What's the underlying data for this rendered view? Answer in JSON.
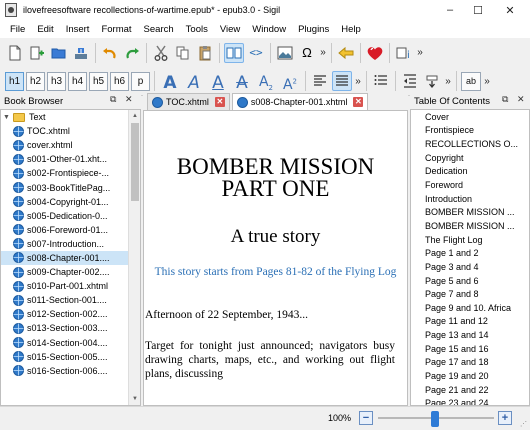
{
  "window": {
    "title": "ilovefreesoftware recollections-of-wartime.epub* - epub3.0 - Sigil",
    "controls": {
      "minimize": "–",
      "maximize": "☐",
      "close": "✕"
    }
  },
  "menu": [
    "File",
    "Edit",
    "Insert",
    "Format",
    "Search",
    "Tools",
    "View",
    "Window",
    "Plugins",
    "Help"
  ],
  "toolbar": {
    "headings": [
      "h1",
      "h2",
      "h3",
      "h4",
      "h5",
      "h6",
      "p"
    ],
    "overflow": "»",
    "case_buttons": [
      "ab"
    ]
  },
  "book_browser": {
    "title": "Book Browser",
    "folder": "Text",
    "files": [
      "TOC.xhtml",
      "cover.xhtml",
      "s001-Other-01.xht...",
      "s002-Frontispiece-...",
      "s003-BookTitlePag...",
      "s004-Copyright-01...",
      "s005-Dedication-0...",
      "s006-Foreword-01...",
      "s007-Introduction...",
      "s008-Chapter-001....",
      "s009-Chapter-002....",
      "s010-Part-001.xhtml",
      "s011-Section-001....",
      "s012-Section-002....",
      "s013-Section-003....",
      "s014-Section-004....",
      "s015-Section-005....",
      "s016-Section-006...."
    ],
    "selected_index": 9
  },
  "tabs": [
    {
      "label": "TOC.xhtml",
      "active": false
    },
    {
      "label": "s008-Chapter-001.xhtml",
      "active": true
    }
  ],
  "document": {
    "title_line1": "BOMBER MISSION",
    "title_line2": "PART ONE",
    "subtitle": "A true story",
    "note": "This story starts from Pages 81-82 of the Flying Log",
    "date": "Afternoon of 22 September, 1943...",
    "paragraph": "Target for tonight just announced; navigators busy drawing charts, maps, etc., and working out flight plans, discussing"
  },
  "toc": {
    "title": "Table Of Contents",
    "entries": [
      "Cover",
      "Frontispiece",
      "RECOLLECTIONS O...",
      "Copyright",
      "Dedication",
      "Foreword",
      "Introduction",
      "BOMBER MISSION ...",
      "BOMBER MISSION ...",
      "The Flight Log",
      "Page 1 and 2",
      "Page 3 and 4",
      "Page 5 and 6",
      "Page 7 and 8",
      "Page 9 and 10. Africa",
      "Page 11 and 12",
      "Page 13 and 14",
      "Page 15 and 16",
      "Page 17 and 18",
      "Page 19 and 20",
      "Page 21 and 22",
      "Page 23 and 24"
    ]
  },
  "status": {
    "zoom": "100%",
    "zoom_out": "−",
    "zoom_in": "+",
    "zoom_level_fraction": 0.5
  },
  "colors": {
    "accent": "#2e7bd6",
    "selected": "#cce4f7",
    "link_text": "#2a6fb5"
  }
}
